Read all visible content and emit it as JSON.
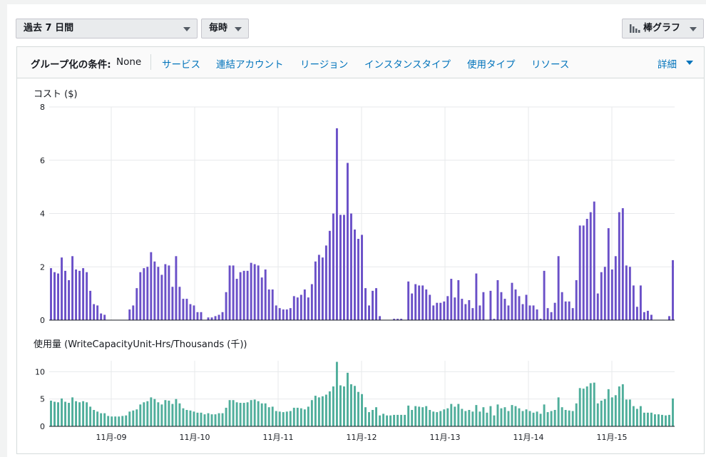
{
  "controls": {
    "date_range": "過去 7 日間",
    "granularity": "毎時",
    "chart_style": "棒グラフ"
  },
  "group_bar": {
    "label": "グループ化の条件:",
    "value": "None",
    "links": [
      "サービス",
      "連結アカウント",
      "リージョン",
      "インスタンスタイプ",
      "使用タイプ",
      "リソース"
    ],
    "more": "詳細"
  },
  "colors": {
    "cost_bar": "#6a50c8",
    "usage_bar": "#4fae9b",
    "link": "#0073bb"
  },
  "chart_data": [
    {
      "type": "bar",
      "title": "コスト ($)",
      "ylim": [
        0,
        8
      ],
      "yticks": [
        "0",
        "2",
        "4",
        "6",
        "8"
      ],
      "grid": true,
      "categories": [
        "11月-09",
        "11月-10",
        "11月-11",
        "11月-12",
        "11月-13",
        "11月-14",
        "11月-15"
      ],
      "values": [
        1.95,
        1.8,
        1.75,
        2.35,
        1.85,
        1.5,
        2.4,
        1.9,
        1.85,
        1.95,
        1.8,
        1.1,
        0.6,
        0.55,
        0.25,
        0.2,
        0,
        0,
        0,
        0,
        0,
        0,
        0.4,
        0.55,
        1.2,
        1.8,
        1.95,
        2.0,
        2.55,
        2.2,
        2.0,
        1.7,
        2.1,
        2.05,
        1.25,
        2.4,
        1.25,
        0.8,
        0.8,
        0.6,
        0.55,
        0.3,
        0.3,
        0,
        0.1,
        0.1,
        0.15,
        0.2,
        0.3,
        1.05,
        2.05,
        2.05,
        1.55,
        1.8,
        1.85,
        1.85,
        2.15,
        2.1,
        2.05,
        1.6,
        1.9,
        1.15,
        1.15,
        0.55,
        0.45,
        0.4,
        0.4,
        0.45,
        0.9,
        0.85,
        0.95,
        1.15,
        0.85,
        1.35,
        2.2,
        2.45,
        2.35,
        2.8,
        3.35,
        4.0,
        7.2,
        3.95,
        3.95,
        5.9,
        4.0,
        3.4,
        3.05,
        3.2,
        1.2,
        0.55,
        1.1,
        1.2,
        0.15,
        0,
        0,
        0,
        0.05,
        0.05,
        0.05,
        0,
        1.45,
        1.0,
        1.35,
        1.3,
        1.3,
        1.15,
        0.95,
        0.55,
        0.65,
        0.65,
        0.7,
        0.9,
        1.55,
        0.85,
        1.5,
        0.8,
        0.6,
        0.75,
        0.45,
        1.75,
        0.55,
        1.05,
        0,
        1.1,
        0.05,
        1.5,
        1.05,
        0.8,
        0.55,
        1.4,
        1.15,
        0.9,
        0.6,
        0.95,
        0.55,
        0.55,
        0.4,
        0.05,
        1.85,
        0.45,
        0.3,
        0.65,
        2.4,
        1.05,
        0.7,
        0.7,
        0.45,
        1.5,
        3.55,
        3.55,
        3.8,
        4.05,
        4.45,
        1.0,
        1.8,
        2.0,
        3.45,
        1.9,
        2.4,
        4.05,
        4.2,
        2.05,
        2.0,
        1.3,
        0.5,
        1.3,
        0.3,
        0.35,
        0.2,
        0,
        0,
        0,
        0,
        0.15,
        2.25
      ]
    },
    {
      "type": "bar",
      "title": "使用量 (WriteCapacityUnit-Hrs/Thousands (千))",
      "ylim": [
        0,
        12
      ],
      "yticks": [
        "0",
        "5",
        "10"
      ],
      "grid": true,
      "categories": [
        "11月-09",
        "11月-10",
        "11月-11",
        "11月-12",
        "11月-13",
        "11月-14",
        "11月-15"
      ],
      "values": [
        4.7,
        4.5,
        4.4,
        5.1,
        4.5,
        4.3,
        5.3,
        4.6,
        4.4,
        4.6,
        4.4,
        3.6,
        3.0,
        2.7,
        2.4,
        2.4,
        1.9,
        1.8,
        1.8,
        1.8,
        1.9,
        2.0,
        2.7,
        2.9,
        3.1,
        4.0,
        4.4,
        4.6,
        5.3,
        5.0,
        4.4,
        4.0,
        4.8,
        4.7,
        4.1,
        5.0,
        4.2,
        3.3,
        3.0,
        2.9,
        2.7,
        2.5,
        2.5,
        2.2,
        2.4,
        2.2,
        2.2,
        2.4,
        2.4,
        3.4,
        4.8,
        4.8,
        4.4,
        4.3,
        4.3,
        4.4,
        4.8,
        4.9,
        4.6,
        4.2,
        4.2,
        3.5,
        3.6,
        2.8,
        2.7,
        2.6,
        2.7,
        2.8,
        3.4,
        3.4,
        3.3,
        3.1,
        3.6,
        4.8,
        5.6,
        5.3,
        5.5,
        5.8,
        6.4,
        7.3,
        11.8,
        7.5,
        7.3,
        9.8,
        7.7,
        7.4,
        6.3,
        5.9,
        3.5,
        2.6,
        3.0,
        3.5,
        2.0,
        2.3,
        2.0,
        2.0,
        2.1,
        2.1,
        2.1,
        2.1,
        3.8,
        3.0,
        3.7,
        3.6,
        3.5,
        3.7,
        3.0,
        2.7,
        2.6,
        2.8,
        3.1,
        3.3,
        4.1,
        3.6,
        4.1,
        3.2,
        2.8,
        3.0,
        2.7,
        3.9,
        2.7,
        3.5,
        2.5,
        3.7,
        2.0,
        4.0,
        3.3,
        3.5,
        2.8,
        3.9,
        3.7,
        3.3,
        2.8,
        3.1,
        2.8,
        2.5,
        2.7,
        2.3,
        4.0,
        2.6,
        2.8,
        3.0,
        5.3,
        3.5,
        3.0,
        2.9,
        2.8,
        4.2,
        7.0,
        6.9,
        7.3,
        7.9,
        8.0,
        4.2,
        4.7,
        5.0,
        6.8,
        5.3,
        5.7,
        7.3,
        7.7,
        4.9,
        4.9,
        3.7,
        3.2,
        3.7,
        2.5,
        2.5,
        2.5,
        2.2,
        2.2,
        2.1,
        2.0,
        2.1,
        5.1
      ]
    }
  ]
}
